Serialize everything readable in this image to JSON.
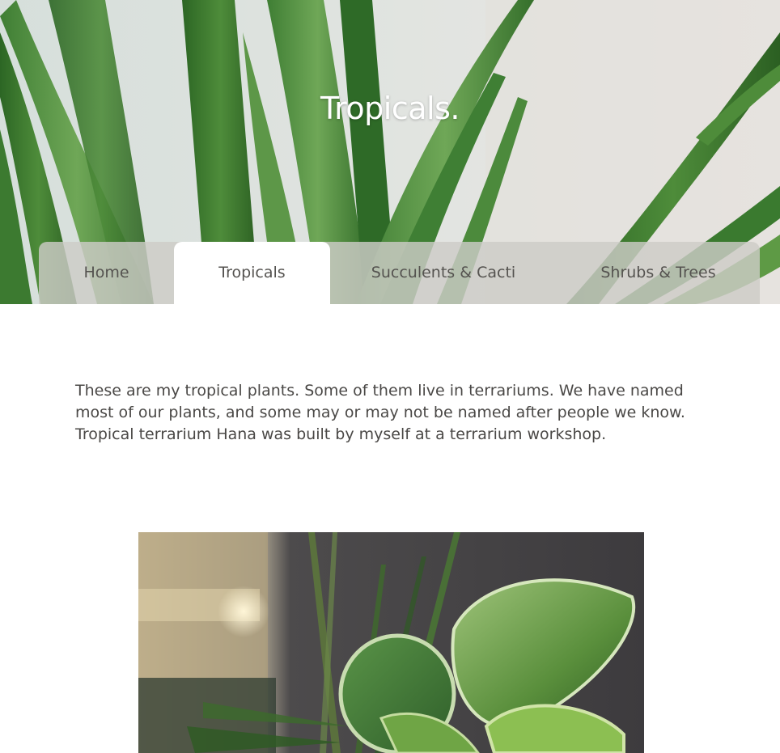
{
  "hero": {
    "title": "Tropicals."
  },
  "nav": {
    "items": [
      {
        "label": "Home",
        "active": false
      },
      {
        "label": "Tropicals",
        "active": true
      },
      {
        "label": "Succulents & Cacti",
        "active": false
      },
      {
        "label": "Shrubs & Trees",
        "active": false
      }
    ]
  },
  "main": {
    "intro": "These are my tropical plants. Some of them live in terrariums. We have named most of our plants, and some may or may not be named after people we know. Tropical terrarium Hana was built by myself at a terrarium workshop."
  },
  "colors": {
    "nav_bg": "#cdccc7",
    "active_tab_bg": "#ffffff",
    "text": "#4a4846",
    "leaf_dark": "#2f6b2a",
    "leaf_light": "#5e9a45"
  }
}
